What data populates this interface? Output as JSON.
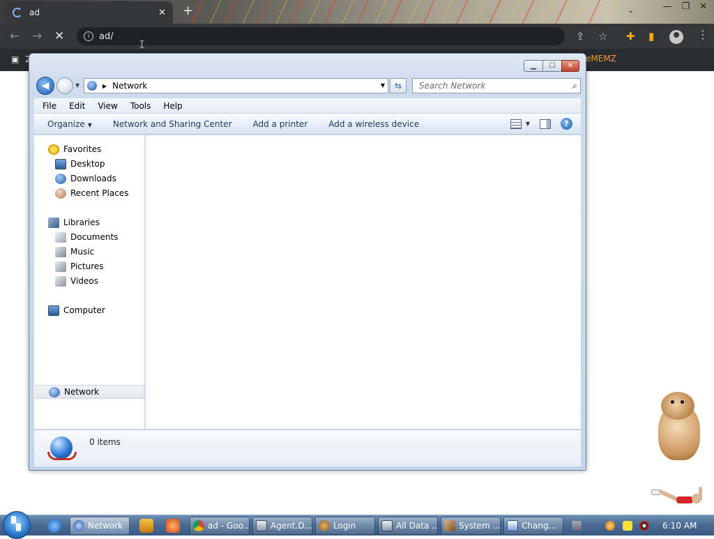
{
  "browser": {
    "tab_title": "ad",
    "tab_close": "✕",
    "new_tab": "+",
    "address": "ad/",
    "bookmark_last": "eMEMZ",
    "bookmark_first": "2",
    "window_controls": {
      "minimize": "—",
      "restore": "❐",
      "close": "✕"
    }
  },
  "explorer": {
    "address_crumb": "Network",
    "search_placeholder": "Search Network",
    "menu": [
      "File",
      "Edit",
      "View",
      "Tools",
      "Help"
    ],
    "commands": {
      "organize": "Organize",
      "network_sharing": "Network and Sharing Center",
      "add_printer": "Add a printer",
      "add_wireless": "Add a wireless device"
    },
    "help_glyph": "?",
    "nav": {
      "favorites": "Favorites",
      "desktop": "Desktop",
      "downloads": "Downloads",
      "recent": "Recent Places",
      "libraries": "Libraries",
      "documents": "Documents",
      "music": "Music",
      "pictures": "Pictures",
      "videos": "Videos",
      "computer": "Computer",
      "network": "Network"
    },
    "items_count": "0 items"
  },
  "taskbar": {
    "buttons": {
      "network": "Network",
      "chrome": "ad - Goo...",
      "agent": "Agent.D...",
      "login": "Login",
      "alldata": "All Data ...",
      "system": "System ...",
      "change": "Chang..."
    },
    "clock": "6:10 AM"
  },
  "colors": {
    "chrome_dark": "#35363a",
    "explorer_frame": "#c3d5ea",
    "taskbar": "#4a6b93",
    "close_red": "#c0412a"
  }
}
